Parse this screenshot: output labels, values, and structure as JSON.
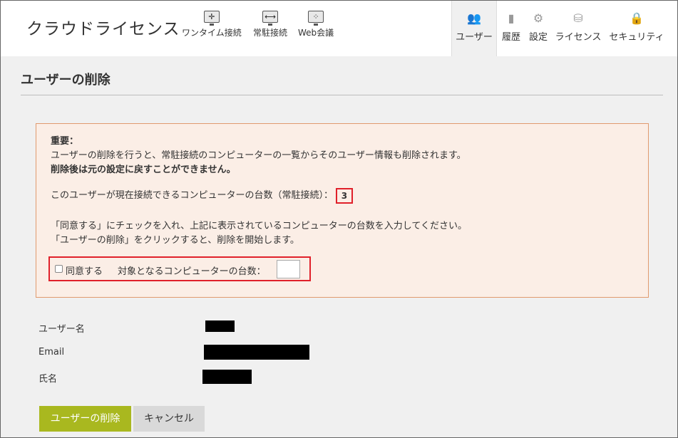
{
  "header": {
    "logo": "クラウドライセンス",
    "quick_links": [
      {
        "label": "ワンタイム接続",
        "icon": "onetime-connect-icon"
      },
      {
        "label": "常駐接続",
        "icon": "resident-connect-icon"
      },
      {
        "label": "Web会議",
        "icon": "web-meeting-icon"
      }
    ],
    "nav": [
      {
        "label": "ユーザー",
        "icon": "users-icon",
        "active": true
      },
      {
        "label": "履歴",
        "icon": "history-icon"
      },
      {
        "label": "設定",
        "icon": "gear-icon"
      },
      {
        "label": "ライセンス",
        "icon": "license-icon"
      },
      {
        "label": "セキュリティ",
        "icon": "lock-icon"
      }
    ]
  },
  "page": {
    "title": "ユーザーの削除"
  },
  "warning": {
    "heading": "重要：",
    "line1": "ユーザーの削除を行うと、常駐接続のコンピューターの一覧からそのユーザー情報も削除されます。",
    "line2": "削除後は元の設定に戻すことができません。",
    "count_label": "このユーザーが現在接続できるコンピューターの台数（常駐接続）：",
    "count_value": "3",
    "instruction1": "「同意する」にチェックを入れ、上記に表示されているコンピューターの台数を入力してください。",
    "instruction2": "「ユーザーの削除」をクリックすると、削除を開始します。",
    "agree_label": "同意する",
    "target_label": "対象となるコンピューターの台数：",
    "target_value": ""
  },
  "user_info": {
    "username_label": "ユーザー名",
    "email_label": "Email",
    "name_label": "氏名"
  },
  "buttons": {
    "delete": "ユーザーの削除",
    "cancel": "キャンセル"
  },
  "colors": {
    "accent_green": "#a9b81f",
    "warning_bg": "#fbeee6",
    "warning_border": "#e09a6e",
    "highlight_red": "#e0202a"
  }
}
